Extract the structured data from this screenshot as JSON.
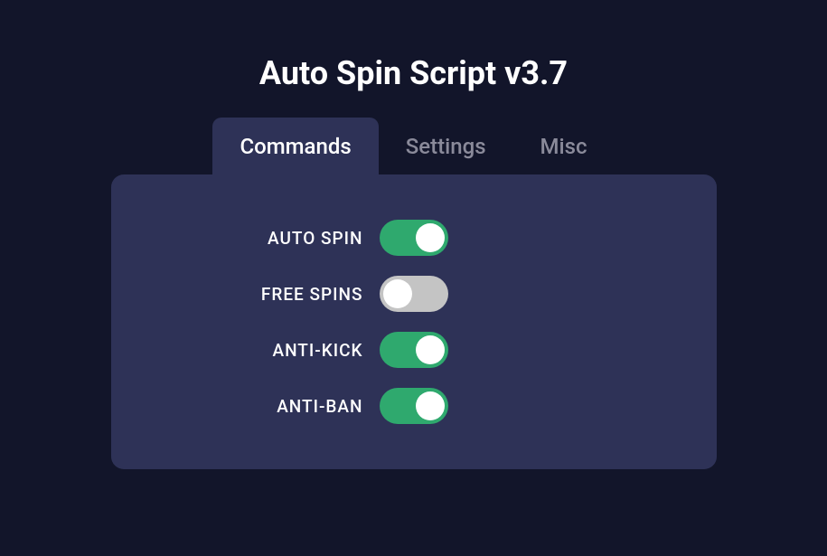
{
  "title": "Auto Spin Script v3.7",
  "tabs": [
    {
      "label": "Commands",
      "active": true
    },
    {
      "label": "Settings",
      "active": false
    },
    {
      "label": "Misc",
      "active": false
    }
  ],
  "settings": [
    {
      "label": "AUTO SPIN",
      "enabled": true
    },
    {
      "label": "FREE SPINS",
      "enabled": false
    },
    {
      "label": "ANTI-KICK",
      "enabled": true
    },
    {
      "label": "ANTI-BAN",
      "enabled": true
    }
  ]
}
